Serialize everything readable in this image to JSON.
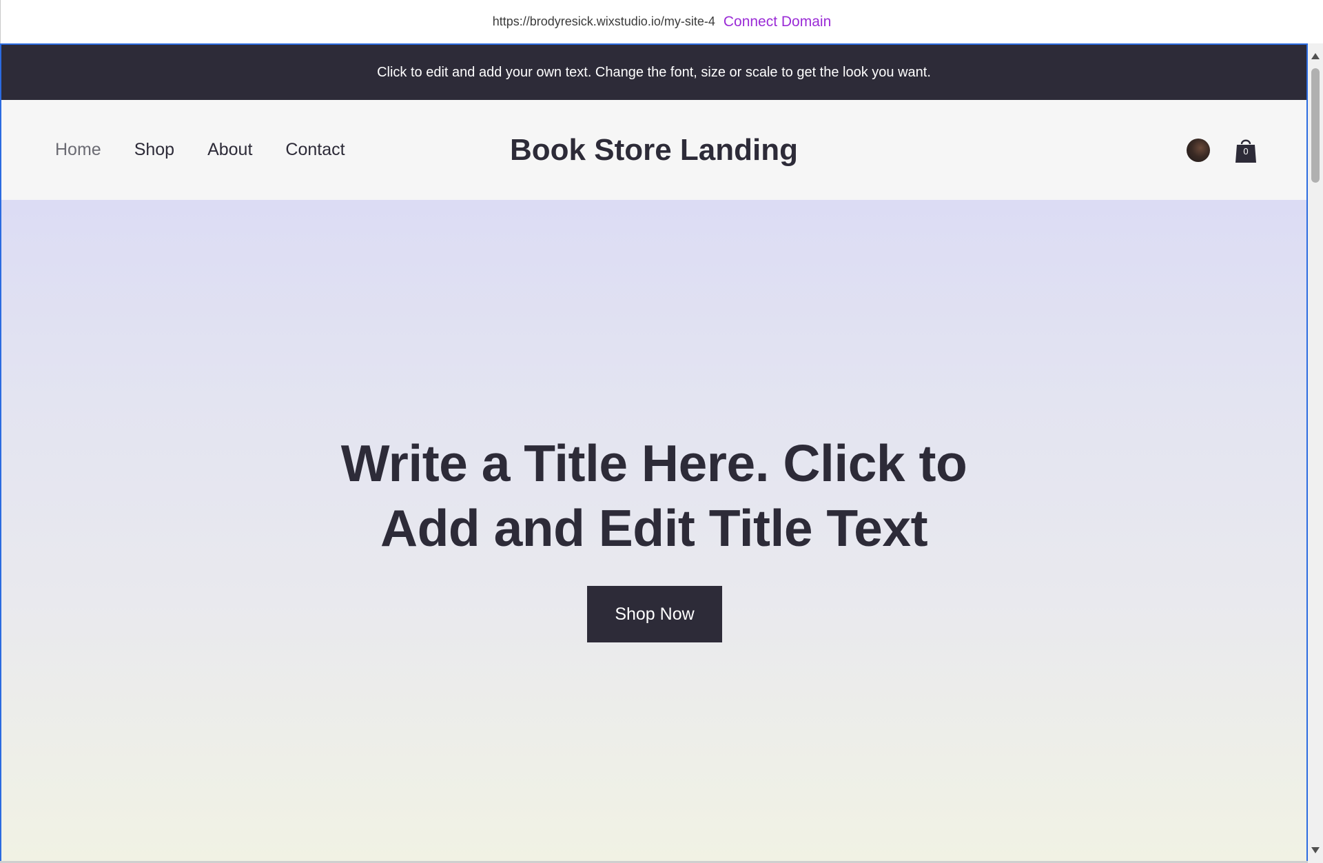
{
  "topbar": {
    "url": "https://brodyresick.wixstudio.io/my-site-4",
    "connect_domain": "Connect Domain"
  },
  "announcement": {
    "text": "Click to edit and add your own text. Change the font, size or scale to get the look you want."
  },
  "header": {
    "nav": [
      {
        "label": "Home",
        "active": true
      },
      {
        "label": "Shop",
        "active": false
      },
      {
        "label": "About",
        "active": false
      },
      {
        "label": "Contact",
        "active": false
      }
    ],
    "site_title": "Book Store Landing",
    "cart_count": "0"
  },
  "hero": {
    "title_line1": "Write a Title Here. Click to",
    "title_line2": "Add and Edit Title Text",
    "button_label": "Shop Now"
  },
  "colors": {
    "dark": "#2d2b38",
    "accent_purple": "#9a2bd6",
    "frame_blue": "#2b6be0"
  },
  "icons": {
    "avatar": "user-avatar",
    "cart": "shopping-bag-icon"
  }
}
